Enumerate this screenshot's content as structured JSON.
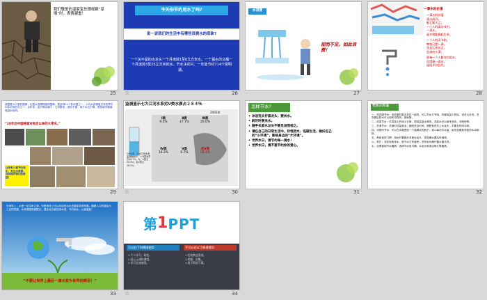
{
  "slides": [
    {
      "number": "25",
      "caption": "我们敬爱的温家宝总理视察“旱情”时，表情凝重！"
    },
    {
      "number": "26",
      "title": "今天你节约用水了吗?",
      "question": "说一说我们的生活中有哪些浪费水的现象?",
      "body": "一个关不紧的水龙头一个月滴掉1至6立方米水。一个漏水的马桶一个月流掉3至25立方米的水。节水决农村、一年能节约714个昆明湖。"
    },
    {
      "number": "27",
      "tag": "水浪费",
      "bubble": "视而不见，如此浪费！"
    },
    {
      "number": "28",
      "heading": "一滴水的价值",
      "lines": [
        "一滴水的价值",
        "滴水成河，",
        "能汇聚大江；",
        "一个人的滴水节约，",
        "一滴水，",
        "或许就能救起生命。",
        "",
        "一个人的无节制，",
        "哪怕只是一滴，",
        "也会汇成长江，",
        "会流向沙漠；",
        "",
        "愿每一个人都节约用水，",
        "珍惜每一滴水，",
        "留给子孙后代。"
      ]
    },
    {
      "number": "29",
      "intro": "我国是人口多的国家，也是水资源短缺的国家，是全球13个贫水国之一，人均水资源量只有世界平均水平的四分之一。近年来，由于降水偏少，江河断流，湖泊干涸，地下水位下降，很多城市都面临缺水危机。",
      "quote": "“20年后中国将面对有史以来的大旱灾。”",
      "boxnote": "让所有人都节约用水，关注水资源，共同保护我们的家园！"
    },
    {
      "number": "30",
      "title": "监测显示七大江河水系劣Ⅴ类水质占２８４％",
      "year": "2001年",
      "cols": [
        "Ⅰ类",
        "Ⅱ类",
        "Ⅲ类",
        "Ⅳ类",
        "Ⅴ类",
        "劣Ⅴ类"
      ],
      "vals": [
        "9.0%",
        "17.7%",
        "20.0%",
        "16.2%",
        "6.7%",
        "28.4%"
      ],
      "note": "2001年，七大江河水系监测断面中，Ⅰ~Ⅲ类水质占46.7%，Ⅳ、Ⅴ类占24.9%，劣Ⅴ类占28.4%。"
    },
    {
      "number": "31",
      "title": "怎样节水?",
      "items": [
        "沐浴洗头拧紧龙头，要关水。",
        "刷牙时要关水。",
        "随手关紧水龙头不要见流而视之。",
        "请在自己的日常生活中，珍惜用水，低碳生活，做好自己的“小环境”，影响身边的“大环境”。",
        "世界水日，请节约每一滴水！",
        "世界水日，请不要节约你的爱心。"
      ]
    },
    {
      "number": "32",
      "title": "节水小方法",
      "paras": [
        "一、洗衣服节水：洗衣服时集中多件一起洗，可以节水又节电。衣服用量少的话，也可以手洗，洗衣服后的水可以用来冲厕所、拖地等。",
        "二、洗菜节水：先将菜上的泥土去掉，再用盆接水清洗，洗菜水可以用来浇花、冲厕所等。",
        "三、洗澡节水：洗澡时尽量淋浴，缩短洗浴时间，擦肥皂时关上水龙头，不要长时间冲淋。",
        "四、冲厕所节水：可以在水箱里放一个装满水的瓶子，减少每次冲水量，用洗衣服和洗菜的水冲厕所。",
        "五、养成良好习惯：用水时要随手关紧水龙头，发现漏水要及时维修。",
        "六、其它：浇花用淘米水，既节水又有营养；洗车用水桶代替水管冲洗。",
        "七、合理使用节水器具：选择节水型马桶、水龙头和淋浴喷头等器具。"
      ]
    },
    {
      "number": "33",
      "intro": "在地球上，水是一切生命之源，但是地球上可以利用的淡水资源却非常有限。随着人口的增加与工业的发展，水资源越来越匮乏，很多地方都在闹水荒。节约用水，从我做起！",
      "slogan": "“不要让世界上最后一滴水变为世界的眼泪！”"
    },
    {
      "number": "34",
      "logo_main": "第",
      "logo_num": "1",
      "logo_rest": "PPT",
      "left_title": "可以在下列情境使用",
      "right_title": "不可以在以下情境使用",
      "left_items": [
        "1.个人学习、研究。",
        "2.自己上课的课堂。",
        "3.学习交流使用。"
      ],
      "right_items": [
        "1.任何商业用途。",
        "2.转载、出售。",
        "3.用于网站下载。"
      ]
    }
  ]
}
